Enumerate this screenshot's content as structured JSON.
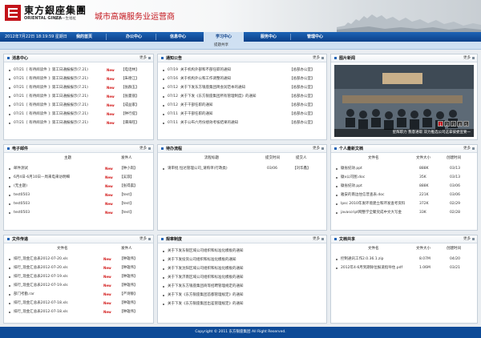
{
  "header": {
    "logo_cn": "東方銀座集團",
    "logo_en": "ORIENTAL GINZA",
    "logo_sub": "源承一生福祉",
    "slogan": "城市高端服务业运营商"
  },
  "nav": {
    "datetime": "2012年7月22日 18:19:59 星期日",
    "tabs": [
      "我的首页",
      "办公中心",
      "信息中心",
      "学习中心",
      "服务中心",
      "管理中心"
    ],
    "active_tab": "学习中心",
    "sub_item": "提题共享"
  },
  "more_label": "更多",
  "panels": {
    "messages": {
      "title": "消息中心",
      "rows": [
        {
          "date": "07/21",
          "text": "[ 有待阅读件 ]: 第工日通报报示(7.21)",
          "author": "【电话林】"
        },
        {
          "date": "07/21",
          "text": "[ 有待阅读件 ]: 第工日通报报示(7.21)",
          "author": "【朱德江】"
        },
        {
          "date": "07/21",
          "text": "[ 有待阅读件 ]: 第工日通报报示(7.21)",
          "author": "【张群玉】"
        },
        {
          "date": "07/21",
          "text": "[ 有待阅读件 ]: 第工日通报报示(7.21)",
          "author": "【张曼丽】"
        },
        {
          "date": "07/21",
          "text": "[ 有待阅读件 ]: 第工日通报报示(7.21)",
          "author": "【成益家】"
        },
        {
          "date": "07/21",
          "text": "[ 有待阅读件 ]: 第工日通报报示(7.21)",
          "author": "【钟行提】"
        },
        {
          "date": "07/21",
          "text": "[ 有待阅读件 ]: 第工日通报报示(7.21)",
          "author": "【谭海旺】"
        }
      ]
    },
    "notices": {
      "title": "通知公告",
      "rows": [
        {
          "date": "07/19",
          "text": "关于机构外部和不部任职的通知",
          "author": "【总部办公室】"
        },
        {
          "date": "07/16",
          "text": "关于机构外公和工作调整的通知",
          "author": "【总部办公室】"
        },
        {
          "date": "07/12",
          "text": "关于下发东方银座集团简会润范本的通知",
          "author": "【总部办公室】"
        },
        {
          "date": "07/12",
          "text": "关于下发《东方银座集团所有管理制度》的通知",
          "author": "【总部办公室】"
        },
        {
          "date": "07/12",
          "text": "关于干部任职的通知",
          "author": "【总部办公室】"
        },
        {
          "date": "07/11",
          "text": "关于干部任职的通知",
          "author": "【总部办公室】"
        },
        {
          "date": "07/11",
          "text": "关于公布六月份绩效考核结果的通知",
          "author": "【总部办公室】"
        }
      ]
    },
    "photos": {
      "title": "图片新闻",
      "caption": "星辉职力 我意进取 双力推选公司这拿彼委宣要一",
      "pages": [
        "1",
        "2",
        "3",
        "4",
        "5"
      ]
    },
    "mail": {
      "title": "电子邮件",
      "col_subject": "主题",
      "col_sender": "发件人",
      "rows": [
        {
          "text": "邮件测试",
          "author": "【钟小岗】"
        },
        {
          "text": "6月4日-6月10日—周来电来访明细",
          "author": "【吴淑】"
        },
        {
          "text": "(无主题)",
          "author": "【张得晨】"
        },
        {
          "text": "test0503",
          "author": "【test】"
        },
        {
          "text": "test0503",
          "author": "【test】"
        },
        {
          "text": "test0503",
          "author": "【test】"
        }
      ]
    },
    "workflow": {
      "title": "待办流程",
      "col_name": "流程标题",
      "col_time": "提交时间",
      "col_person": "提交人",
      "rows": [
        {
          "text": "请审批 恒达管理公司_请购单(行政类)",
          "time": "03/06",
          "author": "【刘华鑫】"
        }
      ]
    },
    "personal_docs": {
      "title": "个人最新文档",
      "col_name": "文件名",
      "col_size": "文件大小",
      "col_date": "创建时间",
      "rows": [
        {
          "text": "徽省纪效.ppt",
          "size": "888K",
          "date": "03/13"
        },
        {
          "text": "徽x公司图.doc",
          "size": "35K",
          "date": "03/13"
        },
        {
          "text": "徽省纪效.ppt",
          "size": "888K",
          "date": "03/06"
        },
        {
          "text": "雅安的南边住信普查表.doc",
          "size": "221K",
          "date": "03/06"
        },
        {
          "text": "Ipsc 2010年发环境建立和环发查考资料",
          "size": "372K",
          "date": "02/29"
        },
        {
          "text": "javascript网整学全聚究成中文大写金",
          "size": "33K",
          "date": "02/28"
        }
      ]
    },
    "file_transfer": {
      "title": "文件传递",
      "col_name": "文件名",
      "col_sender": "发件人",
      "rows": [
        {
          "text": "排行_现金汇总表2012-07-20.xls",
          "author": "【钟雄伟】"
        },
        {
          "text": "排行_现金汇总表2012-07-20.xls",
          "author": "【钟雄伟】"
        },
        {
          "text": "排行_现金汇总表2012-07-19.xls",
          "author": "【钟雄伟】"
        },
        {
          "text": "排行_现金汇总表2012-07-19.xls",
          "author": "【钟雄伟】"
        },
        {
          "text": "部门考勤.rar",
          "author": "【严诗静】"
        },
        {
          "text": "排行_现金汇总表2012-07-18.xls",
          "author": "【钟雄伟】"
        },
        {
          "text": "排行_现金汇总表2012-07-18.xls",
          "author": "【钟雄伟】"
        }
      ]
    },
    "rules": {
      "title": "规章制度",
      "rows": [
        {
          "text": "关于下发东银区域公司组织和标准化模板的通知"
        },
        {
          "text": "关于下发投资公司组织和标准化模板的通知"
        },
        {
          "text": "关于下发沈阳区域公司组织和标准化模板的通知"
        },
        {
          "text": "关于下发济南区域公司组织和标准化模板的通知"
        },
        {
          "text": "关于下发东方银座集团商等招聘管理规定的通知"
        },
        {
          "text": "关于下发《东方银座集团首都管理规定》的通知"
        },
        {
          "text": "关于下发《东方银座集团出差管理规定》的通知"
        }
      ]
    },
    "doc_share": {
      "title": "文档共享",
      "col_name": "文件名",
      "col_size": "文件大小",
      "col_date": "创建时间",
      "rows": [
        {
          "text": "控制通讯工作2.0.36.1.zip",
          "size": "8.07M",
          "date": "04/20"
        },
        {
          "text": "2012年4-6月到期除位报道指导住.pdf",
          "size": "1.06M",
          "date": "03/21"
        }
      ]
    }
  },
  "new_badge": "New",
  "footer": "Copyright © 2011 东方银座集团 All Right Reserved."
}
